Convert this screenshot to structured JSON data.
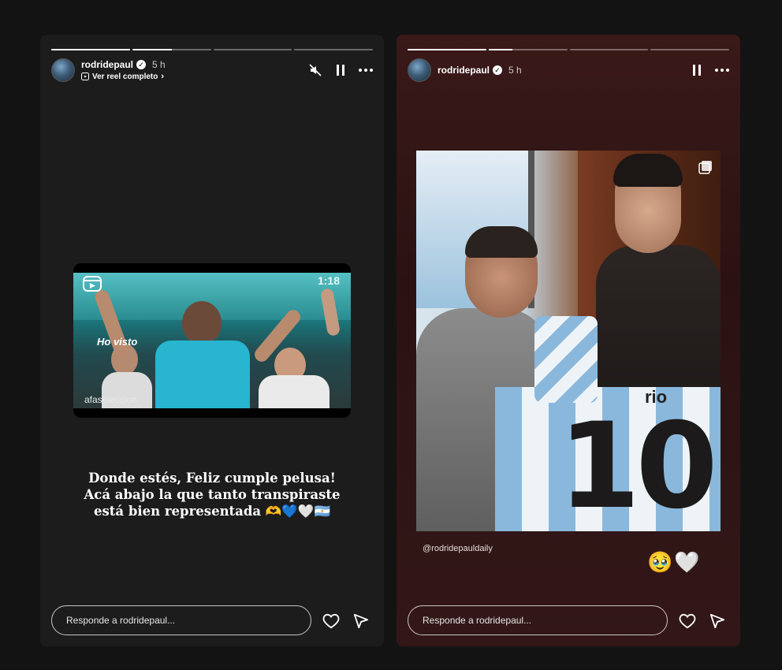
{
  "left_story": {
    "progress_fill": [
      1,
      0.5,
      0,
      0
    ],
    "username": "rodridepaul",
    "time": "5 h",
    "full_reel_link": "Ver reel completo",
    "reel": {
      "duration": "1:18",
      "caption": "Ho visto",
      "handle": "afaseleccion"
    },
    "caption_lines": [
      "Donde estés, Feliz cumple pelusa!",
      "Acá abajo la que tanto transpiraste",
      "está bien representada 🫶💙🤍🇦🇷"
    ],
    "reply_placeholder": "Responde a rodridepaul..."
  },
  "right_story": {
    "progress_fill": [
      1,
      0.3,
      0,
      0,
      0
    ],
    "username": "rodridepaul",
    "time": "5 h",
    "jersey_number": "10",
    "jersey_name": "rio",
    "mention": "@rodridepauldaily",
    "emojis": [
      "🥹",
      "🤍"
    ],
    "reply_placeholder": "Responde a rodridepaul..."
  },
  "icons": {
    "mute": "speaker-muted-icon",
    "pause": "pause-icon",
    "more": "more-horizontal-icon",
    "heart": "heart-icon",
    "send": "send-icon",
    "verified": "verified-badge-icon",
    "reel": "reel-icon",
    "multi_photo": "multi-photo-icon"
  },
  "colors": {
    "left_bg": "#1c1c1c",
    "right_bg": "#3a1919",
    "page_bg": "#131313"
  }
}
